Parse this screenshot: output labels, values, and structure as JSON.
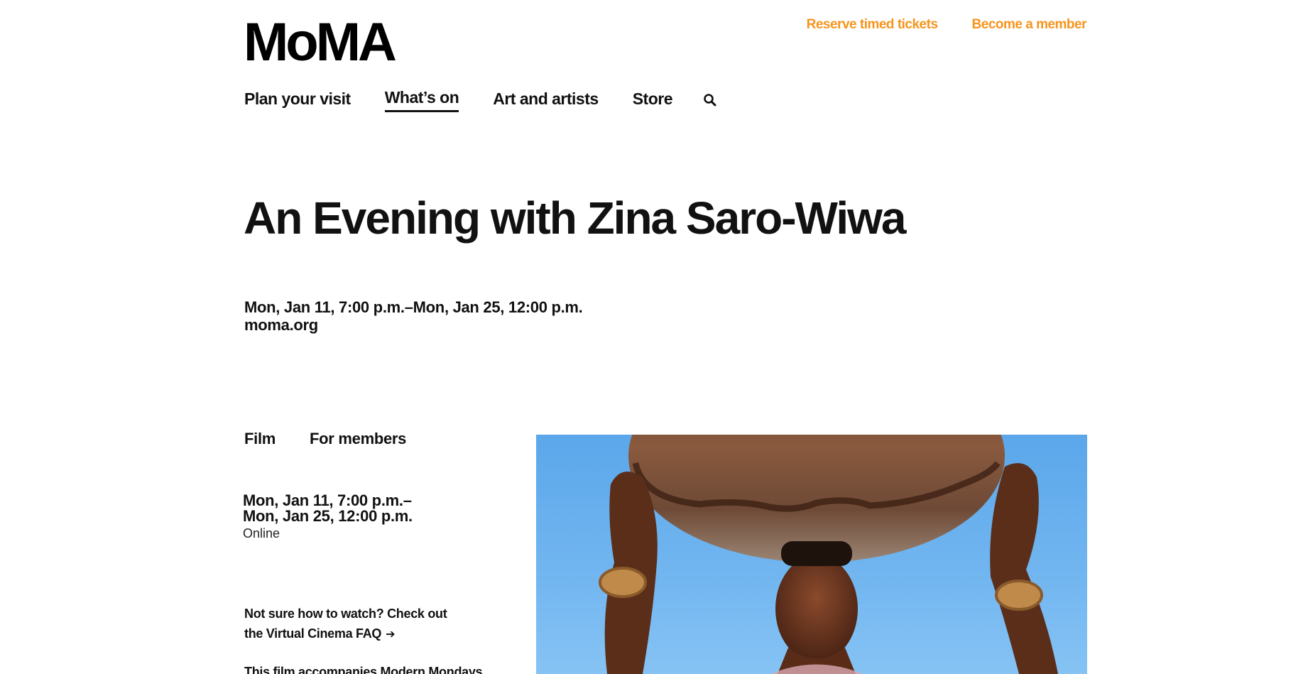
{
  "header": {
    "logo": "MoMA",
    "utility_links": [
      "Reserve timed tickets",
      "Become a member"
    ],
    "accent_color": "#f7941d"
  },
  "nav": {
    "items": [
      "Plan your visit",
      "What’s on",
      "Art and artists",
      "Store"
    ],
    "active": "What’s on",
    "search_icon": "search-icon"
  },
  "event": {
    "title": "An Evening with Zina Saro-Wiwa",
    "date_range": "Mon, Jan 11, 7:00 p.m.–Mon, Jan 25, 12:00 p.m.",
    "site": "moma.org"
  },
  "tags": [
    "Film",
    "For members"
  ],
  "schedule": {
    "date_line_1": "Mon, Jan 11, 7:00 p.m.–",
    "date_line_2": "Mon, Jan 25, 12:00 p.m.",
    "location": "Online"
  },
  "faq": {
    "text": "Not sure how to watch? Check out the Virtual Cinema FAQ",
    "arrow_icon": "arrow-right-icon"
  },
  "more_text": "This film accompanies Modern Mondays"
}
